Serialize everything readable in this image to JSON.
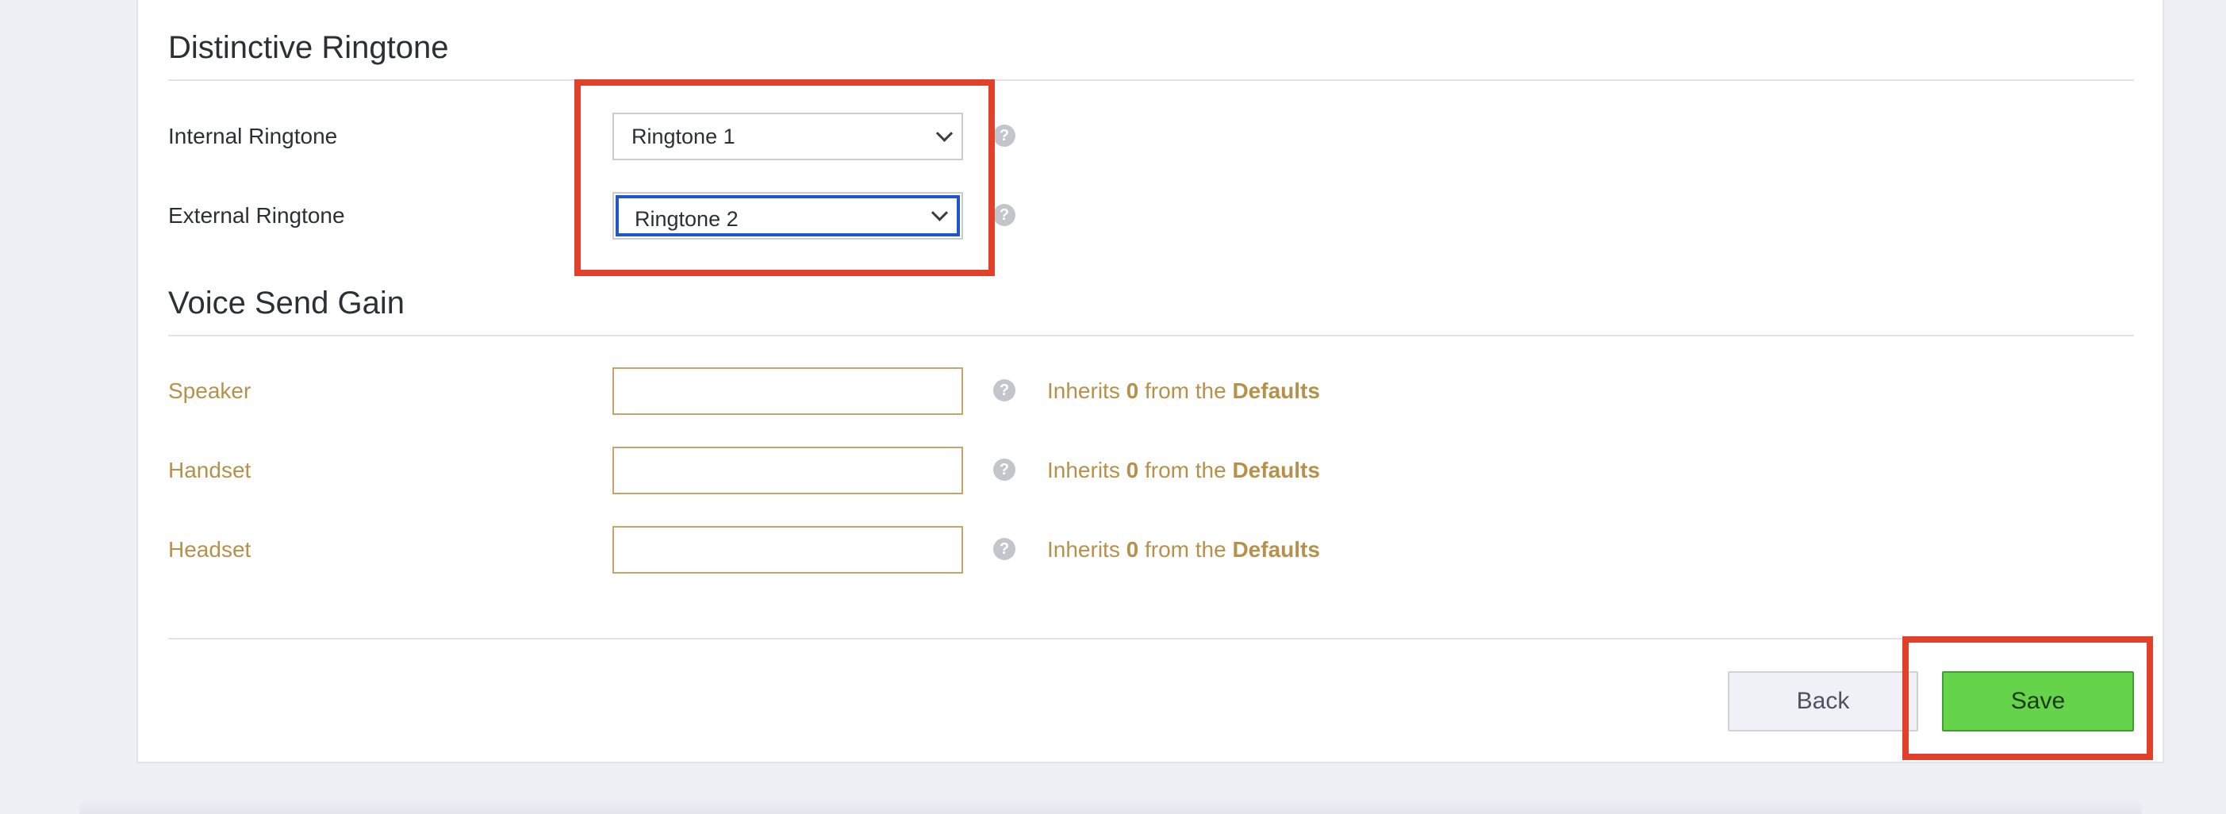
{
  "sections": {
    "ringtone_title": "Distinctive Ringtone",
    "gain_title": "Voice Send Gain"
  },
  "ringtone": {
    "internal_label": "Internal Ringtone",
    "internal_value": "Ringtone 1",
    "external_label": "External Ringtone",
    "external_value": "Ringtone 2"
  },
  "gain": {
    "rows": [
      {
        "label": "Speaker",
        "value": "",
        "inherits_prefix": "Inherits",
        "inherits_value": "0",
        "inherits_mid": "from the",
        "inherits_source": "Defaults"
      },
      {
        "label": "Handset",
        "value": "",
        "inherits_prefix": "Inherits",
        "inherits_value": "0",
        "inherits_mid": "from the",
        "inherits_source": "Defaults"
      },
      {
        "label": "Headset",
        "value": "",
        "inherits_prefix": "Inherits",
        "inherits_value": "0",
        "inherits_mid": "from the",
        "inherits_source": "Defaults"
      }
    ]
  },
  "help_glyph": "?",
  "buttons": {
    "back_label": "Back",
    "save_label": "Save"
  },
  "colors": {
    "inherit_text": "#b7904a",
    "save_green": "#66d44a",
    "highlight_red": "#e3402a",
    "focus_blue": "#1f56c9"
  }
}
